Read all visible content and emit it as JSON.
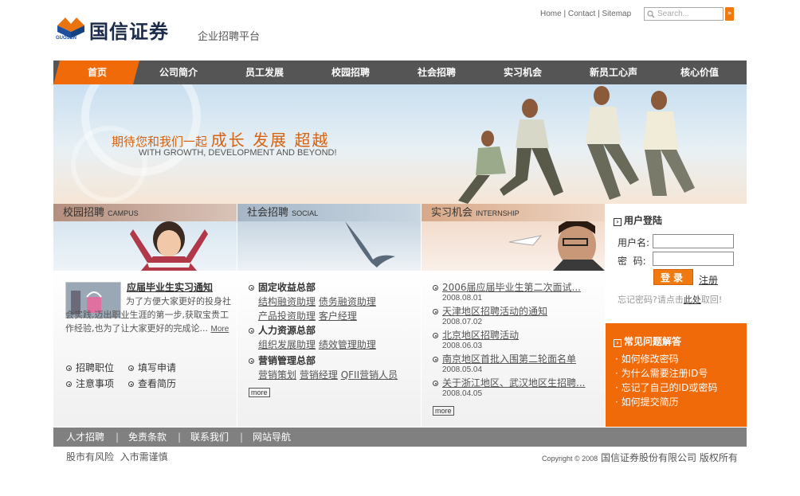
{
  "header": {
    "logo_name": "国信证券",
    "logo_small": "GUOSEN",
    "subtitle": "企业招聘平台",
    "links": [
      "Home",
      "Contact",
      "Sitemap"
    ],
    "search_placeholder": "Search...",
    "search_button": "»"
  },
  "nav": {
    "items": [
      "首页",
      "公司简介",
      "员工发展",
      "校园招聘",
      "社会招聘",
      "实习机会",
      "新员工心声",
      "核心价值"
    ]
  },
  "banner": {
    "line1": "期待您和我们一起",
    "line1_big": "成长 发展 超越",
    "line2": "WITH GROWTH, DEVELOPMENT AND BEYOND!"
  },
  "campus": {
    "title": "校园招聘",
    "title_en": "CAMPUS",
    "news_title": "应届毕业生实习通知",
    "news_body": "为了方便大家更好的投身社会实践,迈出职业生涯的第一步,获取宝贵工作经验,也为了让大家更好的完成论...",
    "more": "More",
    "links": [
      "招聘职位",
      "填写申请",
      "注意事项",
      "查看简历"
    ]
  },
  "social": {
    "title": "社会招聘",
    "title_en": "SOCIAL",
    "groups": [
      {
        "name": "固定收益总部",
        "jobs": [
          "结构融资助理",
          "债务融资助理",
          "产品投资助理",
          "客户经理"
        ]
      },
      {
        "name": "人力资源总部",
        "jobs": [
          "组织发展助理",
          "绩效管理助理"
        ]
      },
      {
        "name": "营销管理总部",
        "jobs": [
          "营销策划",
          "营销经理",
          "QFII营销人员"
        ]
      }
    ],
    "more": "more"
  },
  "intern": {
    "title": "实习机会",
    "title_en": "INTERNSHIP",
    "news": [
      {
        "title": "2006届应届毕业生第二次面试...",
        "date": "2008.08.01"
      },
      {
        "title": "天津地区招聘活动的通知",
        "date": "2008.07.02"
      },
      {
        "title": "北京地区招聘活动",
        "date": "2008.06.03"
      },
      {
        "title": "南京地区首批入围第二轮面名单",
        "date": "2008.05.04"
      },
      {
        "title": "关于浙江地区、武汉地区生招聘...",
        "date": "2008.04.05"
      }
    ],
    "more": "more"
  },
  "login": {
    "title": "用户登陆",
    "username_label": "用户名:",
    "password_label": "密  码:",
    "login_button": "登录",
    "register": "注册",
    "forgot_prefix": "忘记密码?请点击",
    "forgot_link": "此处",
    "forgot_suffix": "取回!"
  },
  "faq": {
    "title": "常见问题解答",
    "items": [
      "如何修改密码",
      "为什么需要注册ID号",
      "忘记了自己的ID或密码",
      "如何提交简历"
    ]
  },
  "footer": {
    "links": [
      "人才招聘",
      "免责条款",
      "联系我们",
      "网站导航"
    ],
    "notice": "股市有风险  入市需谨慎",
    "copyright_prefix": "Copyright © 2008",
    "copyright_company": "国信证券股份有限公司 版权所有"
  },
  "colors": {
    "accent": "#f07a10",
    "nav_bg": "#555555",
    "faq_bg": "#f06a0a",
    "footer_bg": "#808080"
  }
}
